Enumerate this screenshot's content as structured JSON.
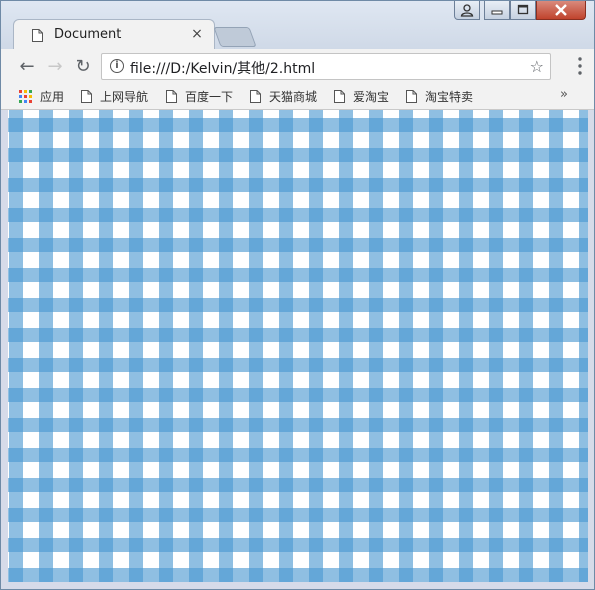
{
  "tab": {
    "title": "Document",
    "close_glyph": "×"
  },
  "toolbar": {
    "back_glyph": "←",
    "forward_glyph": "→",
    "reload_glyph": "↻",
    "url": "file:///D:/Kelvin/其他/2.html",
    "info_glyph": "i",
    "star_glyph": "☆"
  },
  "bookmarks": {
    "items": [
      {
        "label": "应用",
        "icon": "apps-grid-icon"
      },
      {
        "label": "上网导航",
        "icon": "page-icon"
      },
      {
        "label": "百度一下",
        "icon": "page-icon"
      },
      {
        "label": "天猫商城",
        "icon": "page-icon"
      },
      {
        "label": "爱淘宝",
        "icon": "page-icon"
      },
      {
        "label": "淘宝特卖",
        "icon": "page-icon"
      }
    ],
    "more_glyph": "»"
  },
  "content": {
    "pattern": "gingham",
    "stripe_color": "#4a98d1",
    "background_color": "#ffffff"
  }
}
